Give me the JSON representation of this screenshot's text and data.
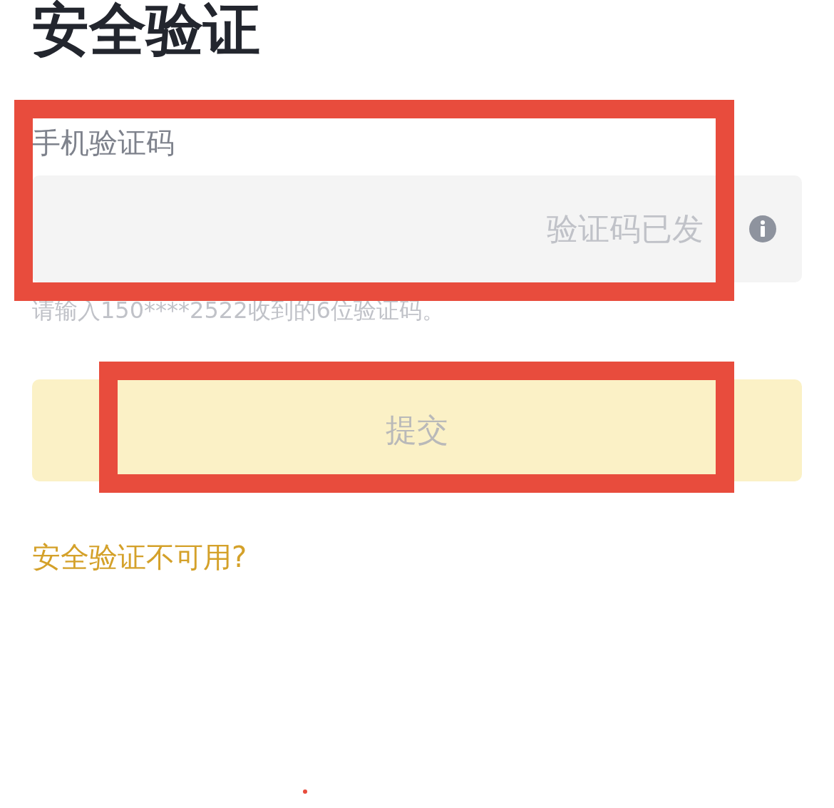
{
  "title": "安全验证",
  "field": {
    "label": "手机验证码",
    "status": "验证码已发",
    "hint": "请输入150****2522收到的6位验证码。",
    "highlighted": true
  },
  "submit": {
    "label": "提交",
    "disabled": true,
    "highlighted": true
  },
  "help_link": "安全验证不可用?"
}
